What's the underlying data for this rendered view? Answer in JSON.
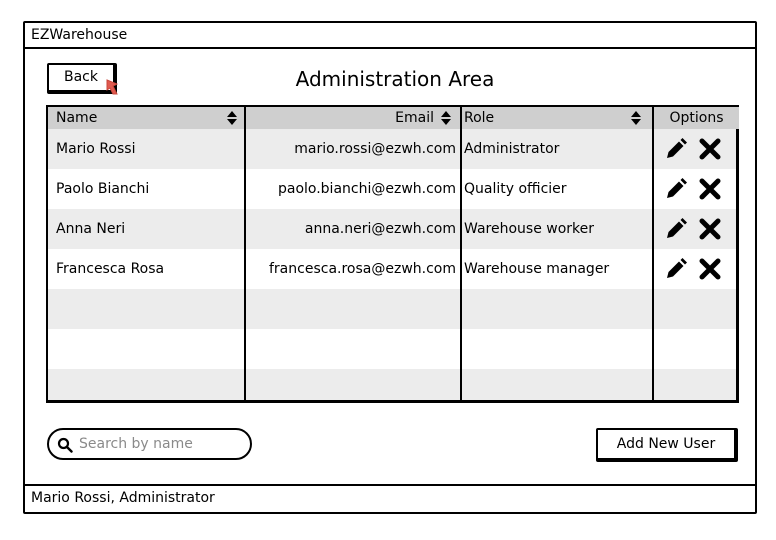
{
  "window": {
    "title": "EZWarehouse"
  },
  "header": {
    "back_label": "Back",
    "page_title": "Administration Area"
  },
  "table": {
    "columns": [
      "Name",
      "Email",
      "Role",
      "Options"
    ],
    "rows": [
      {
        "name": "Mario Rossi",
        "email": "mario.rossi@ezwh.com",
        "role": "Administrator"
      },
      {
        "name": "Paolo Bianchi",
        "email": "paolo.bianchi@ezwh.com",
        "role": "Quality officier"
      },
      {
        "name": "Anna Neri",
        "email": "anna.neri@ezwh.com",
        "role": "Warehouse worker"
      },
      {
        "name": "Francesca Rosa",
        "email": "francesca.rosa@ezwh.com",
        "role": "Warehouse manager"
      }
    ],
    "row_icons": [
      "pencil-icon",
      "close-icon"
    ],
    "header_icons": [
      "sort-icon"
    ]
  },
  "search": {
    "placeholder": "Search by name",
    "value": ""
  },
  "actions": {
    "add_user_label": "Add New User"
  },
  "status": {
    "text": "Mario Rossi, Administrator"
  },
  "colors": {
    "header_bg": "#cfcfcf",
    "row_alt_bg": "#ececec",
    "accent": "#e05a4f"
  }
}
